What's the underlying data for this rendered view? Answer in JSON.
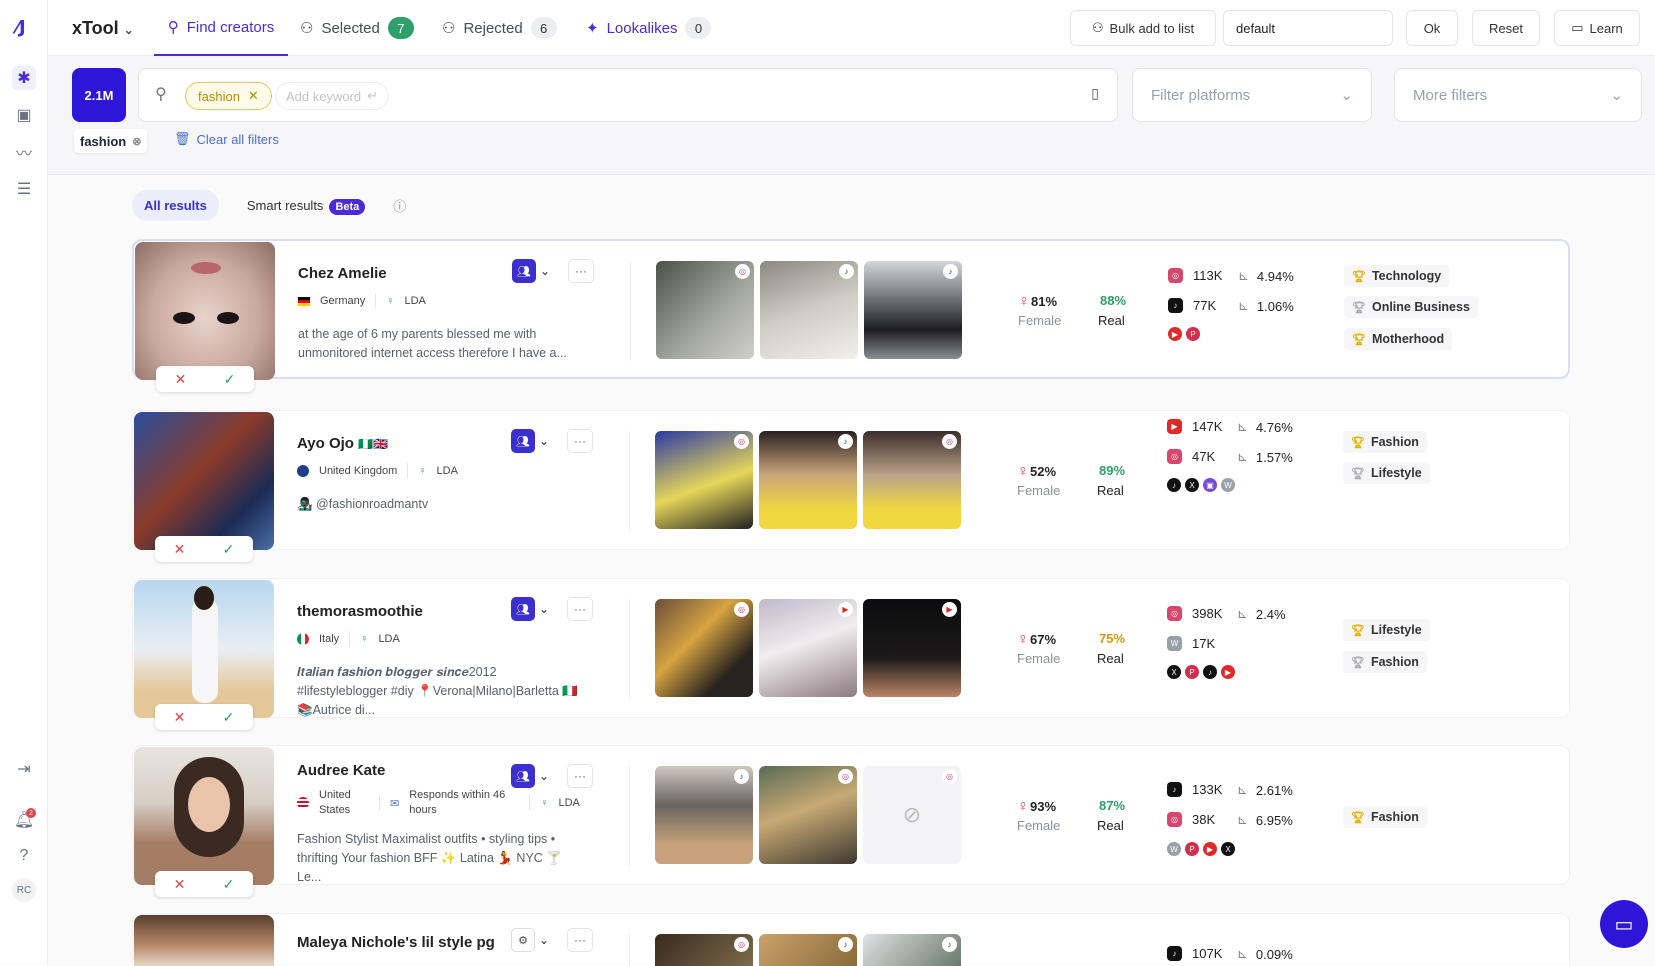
{
  "app": {
    "title": "xTool"
  },
  "tabs": [
    {
      "label": "Find creators"
    },
    {
      "label": "Selected",
      "count": "7"
    },
    {
      "label": "Rejected",
      "count": "6"
    },
    {
      "label": "Lookalikes",
      "count": "0"
    }
  ],
  "toolbar": {
    "bulk_add": "Bulk add to list",
    "list_value": "default",
    "ok": "Ok",
    "reset": "Reset",
    "learn": "Learn"
  },
  "search": {
    "total": "2.1M",
    "keyword": "fashion",
    "add_keyword": "Add keyword",
    "platforms_placeholder": "Filter platforms",
    "more_filters": "More filters"
  },
  "active_filters": {
    "chip": "fashion",
    "clear": "Clear all filters"
  },
  "result_tabs": {
    "all": "All results",
    "smart": "Smart results",
    "beta": "Beta"
  },
  "notifications": {
    "badge": "2"
  },
  "user": {
    "initials": "RC"
  },
  "creators": [
    {
      "name": "Chez Amelie",
      "country": "Germany",
      "lda": "LDA",
      "bio": "at the age of 6 my parents blessed me with unmonitored internet access therefore I have a...",
      "female": "81%",
      "female_label": "Female",
      "real": "88%",
      "real_label": "Real",
      "stats": [
        {
          "platform": "instagram",
          "followers": "113K",
          "engagement": "4.94%"
        },
        {
          "platform": "tiktok",
          "followers": "77K",
          "engagement": "1.06%"
        }
      ],
      "topics": [
        "Technology",
        "Online Business",
        "Motherhood"
      ]
    },
    {
      "name": "Ayo Ojo",
      "flags": "🇳🇬🇬🇧",
      "country": "United Kingdom",
      "lda": "LDA",
      "bio": "👨🏿‍🎤 @fashionroadmantv",
      "female": "52%",
      "female_label": "Female",
      "real": "89%",
      "real_label": "Real",
      "stats": [
        {
          "platform": "youtube",
          "followers": "147K",
          "engagement": "4.76%"
        },
        {
          "platform": "instagram",
          "followers": "47K",
          "engagement": "1.57%"
        }
      ],
      "topics": [
        "Fashion",
        "Lifestyle"
      ]
    },
    {
      "name": "themorasmoothie",
      "country": "Italy",
      "lda": "LDA",
      "bio": "𝑰𝒕𝒂𝒍𝒊𝒂𝒏 𝒇𝒂𝒔𝒉𝒊𝒐𝒏 𝒃𝒍𝒐𝒈𝒈𝒆𝒓 𝒔𝒊𝒏𝒄𝒆2012 #lifestyleblogger #diy 📍Verona|Milano|Barletta 🇮🇹 📚Autrice di...",
      "female": "67%",
      "female_label": "Female",
      "real": "75%",
      "real_label": "Real",
      "stats": [
        {
          "platform": "instagram",
          "followers": "398K",
          "engagement": "2.4%"
        },
        {
          "platform": "wordpress",
          "followers": "17K",
          "engagement": ""
        }
      ],
      "topics": [
        "Lifestyle",
        "Fashion"
      ]
    },
    {
      "name": "Audree Kate",
      "country": "United States",
      "responds": "Responds within 46 hours",
      "lda": "LDA",
      "bio": "Fashion Stylist Maximalist outfits • styling tips • thrifting Your fashion BFF ✨ Latina 💃 NYC 🍸 Le...",
      "female": "93%",
      "female_label": "Female",
      "real": "87%",
      "real_label": "Real",
      "stats": [
        {
          "platform": "tiktok",
          "followers": "133K",
          "engagement": "2.61%"
        },
        {
          "platform": "instagram",
          "followers": "38K",
          "engagement": "6.95%"
        }
      ],
      "topics": [
        "Fashion"
      ]
    },
    {
      "name": "Maleya Nichole's lil style pg",
      "stats": [
        {
          "platform": "tiktok",
          "followers": "107K",
          "engagement": "0.09%"
        }
      ]
    }
  ]
}
